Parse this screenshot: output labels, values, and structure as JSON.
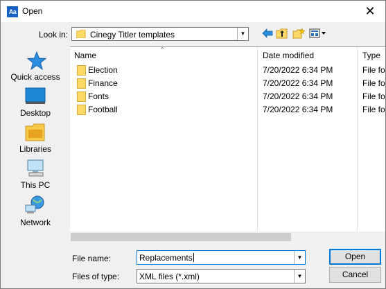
{
  "window": {
    "app_icon_text": "Aa",
    "title": "Open",
    "close_glyph": "✕"
  },
  "toolbar": {
    "look_in_label": "Look in:",
    "look_in_value": "Cinegy Titler templates",
    "icons": [
      "back-arrow-icon",
      "up-folder-icon",
      "new-folder-icon",
      "view-menu-icon"
    ]
  },
  "places": [
    {
      "label": "Quick access",
      "icon": "star-icon"
    },
    {
      "label": "Desktop",
      "icon": "desktop-icon"
    },
    {
      "label": "Libraries",
      "icon": "libraries-icon"
    },
    {
      "label": "This PC",
      "icon": "computer-icon"
    },
    {
      "label": "Network",
      "icon": "network-icon"
    }
  ],
  "list": {
    "columns": [
      "Name",
      "Date modified",
      "Type"
    ],
    "rows": [
      {
        "name": "Election",
        "date": "7/20/2022 6:34 PM",
        "type": "File fo"
      },
      {
        "name": "Finance",
        "date": "7/20/2022 6:34 PM",
        "type": "File fo"
      },
      {
        "name": "Fonts",
        "date": "7/20/2022 6:34 PM",
        "type": "File fo"
      },
      {
        "name": "Football",
        "date": "7/20/2022 6:34 PM",
        "type": "File fo"
      }
    ]
  },
  "form": {
    "file_name_label": "File name:",
    "file_name_value": "Replacements",
    "files_of_type_label": "Files of type:",
    "files_of_type_value": "XML files (*.xml)"
  },
  "buttons": {
    "open": "Open",
    "cancel": "Cancel"
  },
  "colors": {
    "accent": "#0078d7",
    "folder": "#ffd966",
    "app_icon": "#1560c5"
  }
}
